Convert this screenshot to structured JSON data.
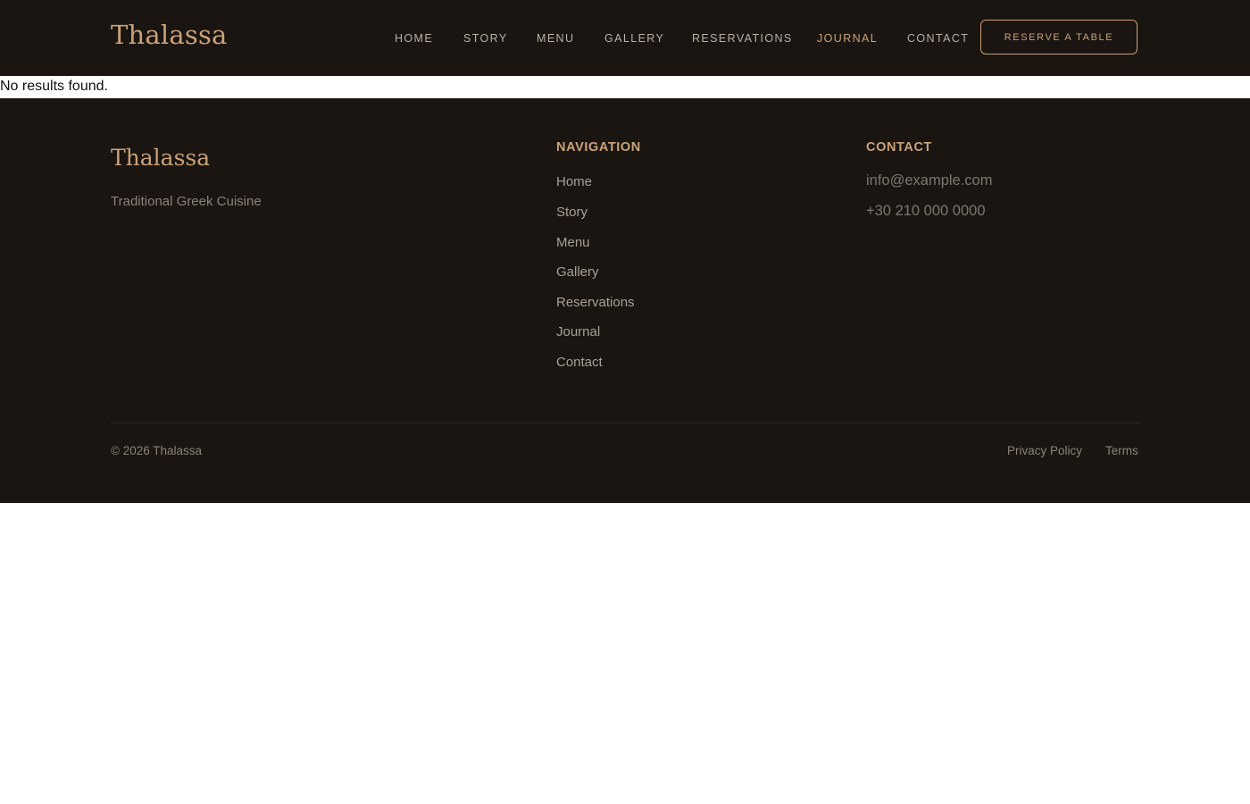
{
  "brand": {
    "name": "Thalassa",
    "accent_color": "#c9a27a",
    "background_color": "#1a1510"
  },
  "header": {
    "nav": [
      {
        "label": "HOME",
        "active": false
      },
      {
        "label": "STORY",
        "active": false
      },
      {
        "label": "MENU",
        "active": false
      },
      {
        "label": "GALLERY",
        "active": false
      },
      {
        "label": "RESERVATIONS",
        "active": false
      },
      {
        "label": "JOURNAL",
        "active": true
      },
      {
        "label": "CONTACT",
        "active": false
      }
    ],
    "cta_label": "RESERVE A TABLE"
  },
  "main": {
    "empty_message": "No results found."
  },
  "footer": {
    "brand_name": "Thalassa",
    "tagline": "Traditional Greek Cuisine",
    "navigation_heading": "NAVIGATION",
    "navigation_links": [
      "Home",
      "Story",
      "Menu",
      "Gallery",
      "Reservations",
      "Journal",
      "Contact"
    ],
    "contact_heading": "CONTACT",
    "email": "info@example.com",
    "phone": "+30 210 000 0000",
    "copyright": "© 2026 Thalassa",
    "legal_links": [
      "Privacy Policy",
      "Terms"
    ]
  }
}
